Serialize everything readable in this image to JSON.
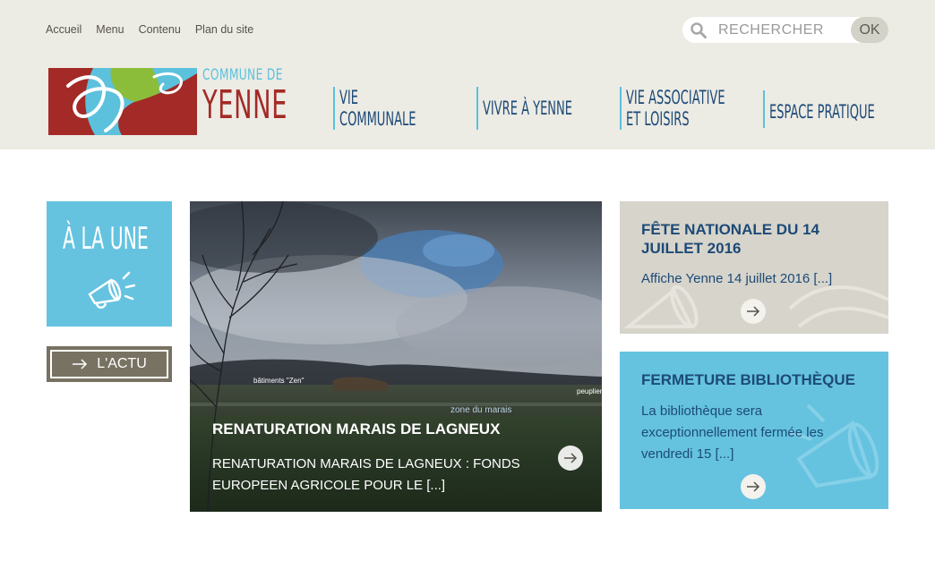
{
  "utility_nav": [
    "Accueil",
    "Menu",
    "Contenu",
    "Plan du site"
  ],
  "search": {
    "placeholder": "RECHERCHER",
    "button_label": "OK"
  },
  "logo": {
    "line1": "COMMUNE DE",
    "line2": "YENNE"
  },
  "main_nav": [
    {
      "line1": "VIE",
      "line2": "COMMUNALE"
    },
    {
      "line1": "VIVRE À YENNE"
    },
    {
      "line1": "VIE ASSOCIATIVE",
      "line2": "ET LOISIRS"
    },
    {
      "line1": "ESPACE PRATIQUE"
    }
  ],
  "a_la_une": {
    "title": "À LA UNE"
  },
  "actu_button": {
    "label": "L'ACTU"
  },
  "featured": {
    "title": "RENATURATION MARAIS DE LAGNEUX",
    "excerpt": "RENATURATION MARAIS DE LAGNEUX : FONDS EUROPEEN AGRICOLE POUR LE [...]",
    "photo_labels": {
      "buildings": "bâtiments \"Zen\"",
      "poplar": "peuplier",
      "marsh": "zone du marais"
    }
  },
  "cards": [
    {
      "title": "FÊTE NATIONALE DU 14 JUILLET 2016",
      "excerpt": "Affiche Yenne 14 juillet 2016 [...]"
    },
    {
      "title": "FERMETURE BIBLIOTHÈQUE",
      "excerpt": "La bibliothèque sera exceptionnellement fermée les vendredi 15 [...]"
    }
  ],
  "colors": {
    "header_bg": "#ecebe4",
    "accent_blue": "#65c3e0",
    "navy": "#1d4a77",
    "brand_red": "#a32a26",
    "olive": "#787262"
  }
}
